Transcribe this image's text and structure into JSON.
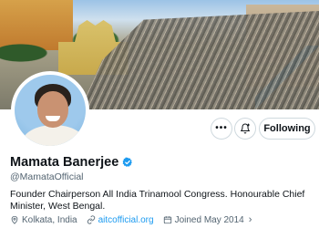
{
  "profile": {
    "name": "Mamata Banerjee",
    "handle": "@MamataOfficial",
    "bio": "Founder Chairperson All India Trinamool Congress. Honourable Chief Minister, West Bengal.",
    "location": "Kolkata, India",
    "website": "aitcofficial.org",
    "joined": "Joined May 2014",
    "verified_color": "#1d9bf0"
  },
  "actions": {
    "more_label": "•••",
    "follow_label": "Following"
  },
  "icons": {
    "more": "more-horizontal-icon",
    "subscribe": "notification-bell-plus-icon",
    "verified": "verified-badge-icon",
    "location": "location-pin-icon",
    "link": "link-icon",
    "calendar": "calendar-icon",
    "chevron": "chevron-right-icon"
  },
  "colors": {
    "text_primary": "#0f1419",
    "text_secondary": "#536471",
    "accent": "#1d9bf0",
    "border": "#cfd9de"
  }
}
